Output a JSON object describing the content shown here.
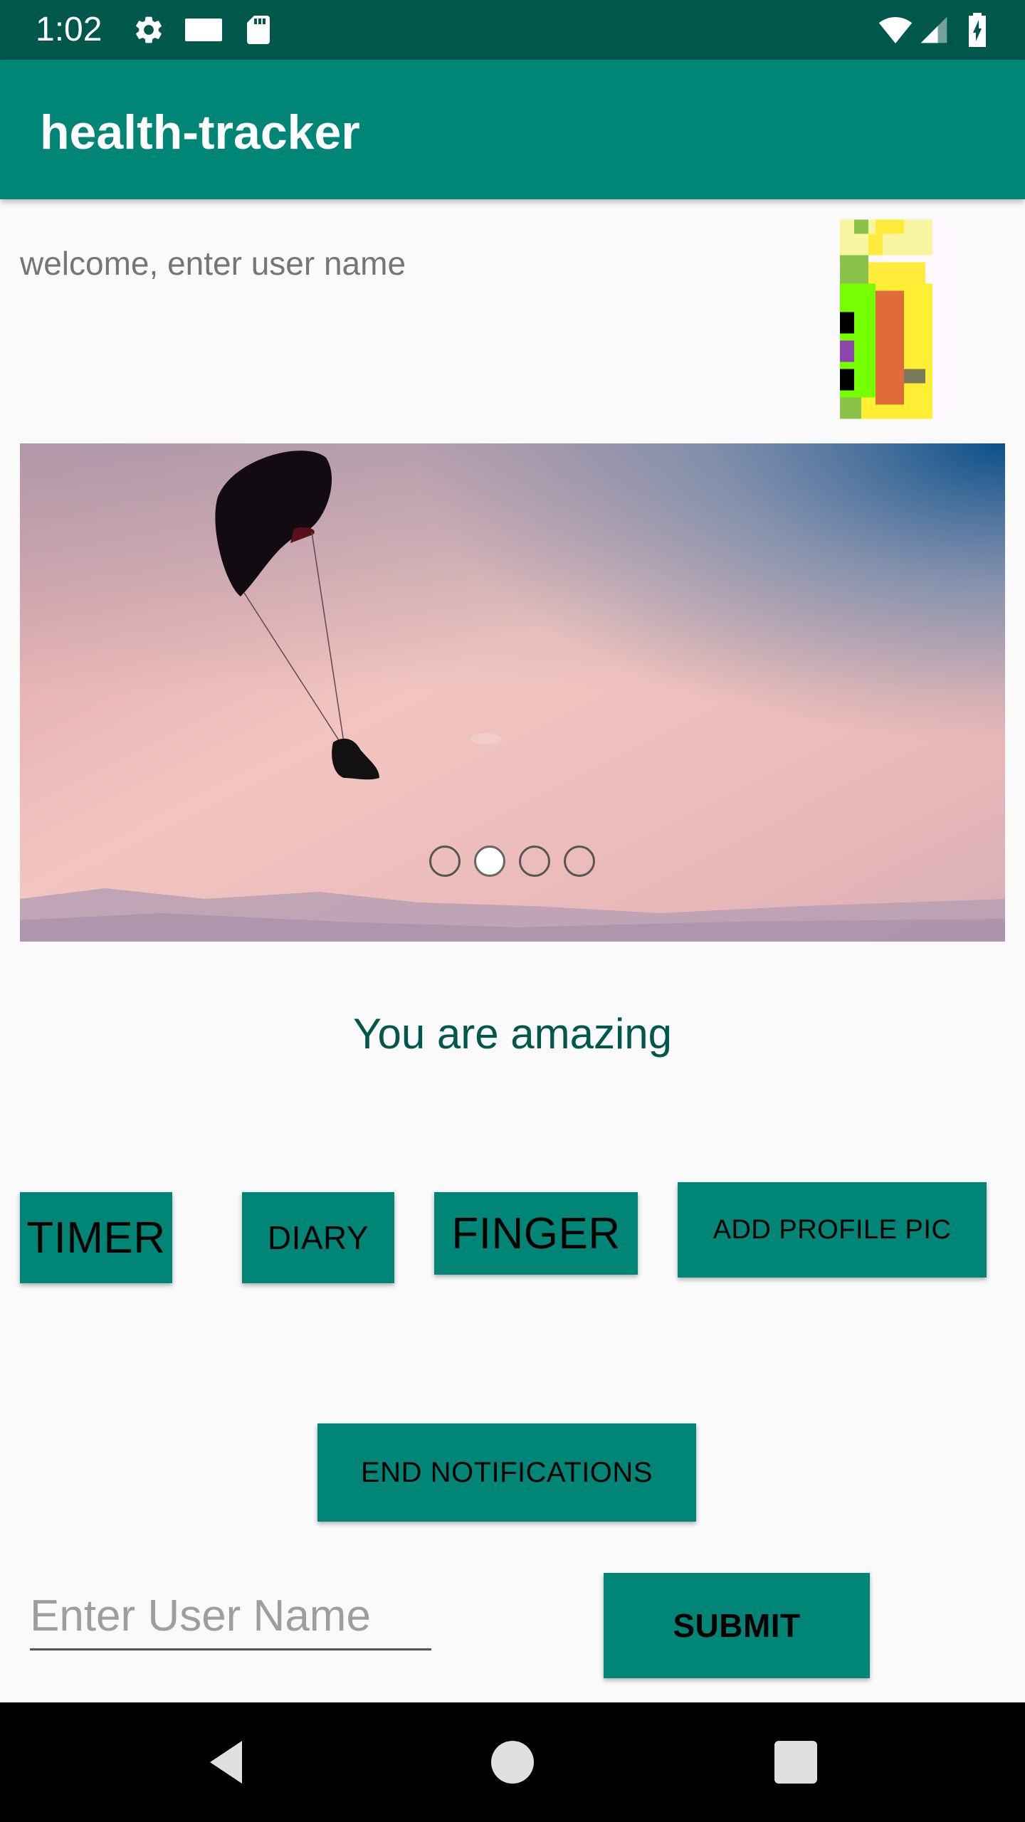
{
  "status_bar": {
    "time": "1:02",
    "icons_left": [
      "settings-icon",
      "notification-square-icon",
      "sd-card-icon"
    ],
    "icons_right": [
      "wifi-icon",
      "cell-signal-icon",
      "battery-charging-icon"
    ]
  },
  "app_bar": {
    "title": "health-tracker"
  },
  "welcome": {
    "text": "welcome, enter user name"
  },
  "avatar": {
    "icon": "pixel-avatar"
  },
  "carousel": {
    "image": "paraglider-sky",
    "dot_count": 4,
    "active_index": 1
  },
  "quote": {
    "text": "You are amazing"
  },
  "buttons": {
    "timer": "TIMER",
    "diary": "DIARY",
    "finger": "FINGER",
    "add_profile_pic": "ADD PROFILE PIC",
    "end_notifications": "END NOTIFICATIONS",
    "submit": "SUBMIT"
  },
  "username_input": {
    "placeholder": "Enter User Name",
    "value": ""
  },
  "nav_bar": {
    "buttons": [
      "back-icon",
      "home-icon",
      "recents-icon"
    ]
  },
  "colors": {
    "primary": "#008577",
    "primary_dark": "#00574b",
    "background": "#fafafa"
  }
}
